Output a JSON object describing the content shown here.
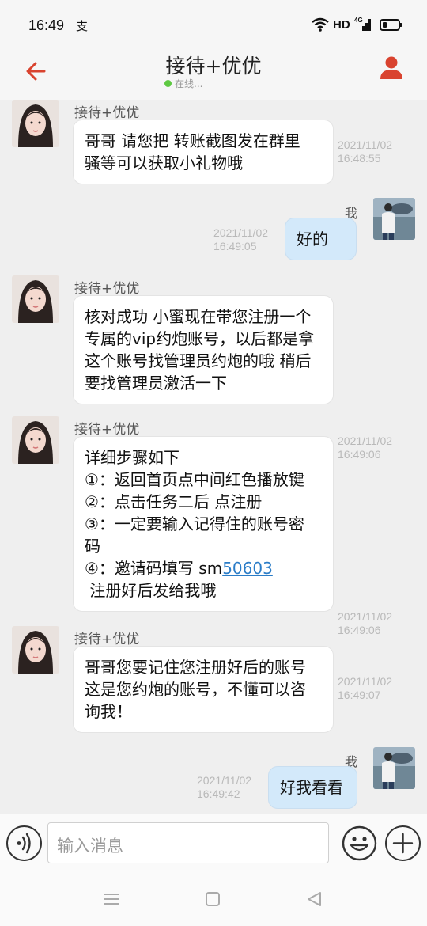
{
  "status_bar": {
    "time": "16:49",
    "notification_icon": "支",
    "network_hd": "HD",
    "network_type": "4G"
  },
  "header": {
    "title": "接待+优优",
    "online_status": "在线..."
  },
  "messages": [
    {
      "side": "left",
      "sender": "接待+优优",
      "lines": [
        "哥哥 请您把 转账截图发在群里",
        "骚等可以获取小礼物哦"
      ],
      "date": "2021/11/02",
      "time": "16:48:55"
    },
    {
      "side": "right",
      "sender": "我",
      "lines": [
        "好的"
      ],
      "date": "2021/11/02",
      "time": "16:49:05"
    },
    {
      "side": "left",
      "sender": "接待+优优",
      "lines": [
        "核对成功 小蜜现在带您注册一个",
        "专属的vip约炮账号，以后都是拿",
        "这个账号找管理员约炮的哦 稍后",
        "要找管理员激活一下"
      ],
      "date": "2021/11/02",
      "time": "16:49:06"
    },
    {
      "side": "left",
      "sender": "接待+优优",
      "lines": [
        "详细步骤如下",
        "①：返回首页点中间红色播放键",
        "②：点击任务二后 点注册",
        "③：一定要输入记得住的账号密",
        "码"
      ],
      "line_before_link": "④：邀请码填写 sm",
      "link_text": "50603",
      "last_line": " 注册好后发给我哦",
      "date": "2021/11/02",
      "time": "16:49:06"
    },
    {
      "side": "left",
      "sender": "接待+优优",
      "lines": [
        "哥哥您要记住您注册好后的账号",
        "这是您约炮的账号，不懂可以咨",
        "询我！"
      ],
      "date": "2021/11/02",
      "time": "16:49:07"
    },
    {
      "side": "right",
      "sender": "我",
      "lines": [
        "好我看看"
      ],
      "date": "2021/11/02",
      "time": "16:49:42"
    }
  ],
  "input": {
    "placeholder": "输入消息"
  },
  "icons": {
    "back": "back-arrow-icon",
    "profile": "user-profile-icon",
    "voice": "voice-icon",
    "emoji": "emoji-icon",
    "plus": "plus-icon",
    "nav_menu": "menu-icon",
    "nav_home": "home-icon",
    "nav_back": "back-triangle-icon"
  },
  "colors": {
    "accent": "#d9432f",
    "online": "#5ec942",
    "my_bubble": "#d3e9fa",
    "link": "#2a7cc7"
  }
}
